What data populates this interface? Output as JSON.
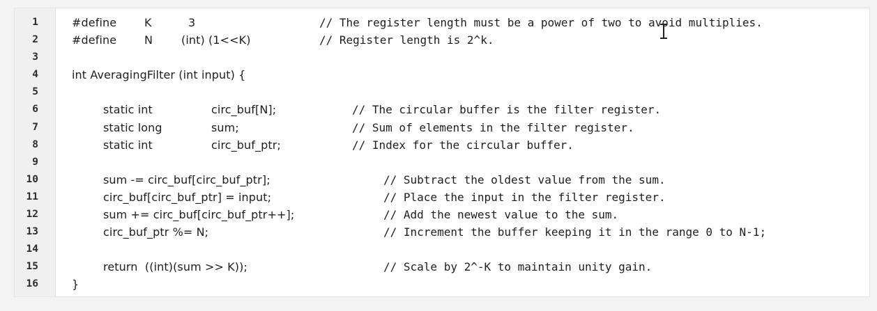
{
  "editor": {
    "lines": [
      {
        "number": "1",
        "code": "",
        "tokens": [
          "#define",
          "K",
          "3"
        ],
        "comment": "// The register length must be a power of two to avoid multiplies."
      },
      {
        "number": "2",
        "code": "",
        "tokens": [
          "#define",
          "N",
          "(int) (1<<K)"
        ],
        "comment": "// Register length is 2^k."
      },
      {
        "number": "3",
        "code": "",
        "tokens": [],
        "comment": ""
      },
      {
        "number": "4",
        "code": "int AveragingFilter (int input) {",
        "tokens": [],
        "comment": ""
      },
      {
        "number": "5",
        "code": "",
        "tokens": [],
        "comment": ""
      },
      {
        "number": "6",
        "code": "",
        "tokens": [
          "static int",
          "circ_buf[N];"
        ],
        "comment": "// The circular buffer is the filter register."
      },
      {
        "number": "7",
        "code": "",
        "tokens": [
          "static long",
          "sum;"
        ],
        "comment": "// Sum of elements in the filter register."
      },
      {
        "number": "8",
        "code": "",
        "tokens": [
          "static int",
          "circ_buf_ptr;"
        ],
        "comment": "// Index for the circular buffer."
      },
      {
        "number": "9",
        "code": "",
        "tokens": [],
        "comment": ""
      },
      {
        "number": "10",
        "code": "sum -= circ_buf[circ_buf_ptr];",
        "tokens": [],
        "comment": "// Subtract the oldest value from the sum."
      },
      {
        "number": "11",
        "code": "circ_buf[circ_buf_ptr] = input;",
        "tokens": [],
        "comment": "// Place the input in the filter register."
      },
      {
        "number": "12",
        "code": "sum += circ_buf[circ_buf_ptr++];",
        "tokens": [],
        "comment": "// Add the newest value to the sum."
      },
      {
        "number": "13",
        "code": "circ_buf_ptr %= N;",
        "tokens": [],
        "comment": "// Increment the buffer keeping it in the range 0 to N-1;"
      },
      {
        "number": "14",
        "code": "",
        "tokens": [],
        "comment": ""
      },
      {
        "number": "15",
        "code": "return  ((int)(sum >> K));",
        "tokens": [],
        "comment": "// Scale by 2^-K to maintain unity gain."
      },
      {
        "number": "16",
        "code": "}",
        "tokens": [],
        "comment": ""
      }
    ]
  }
}
